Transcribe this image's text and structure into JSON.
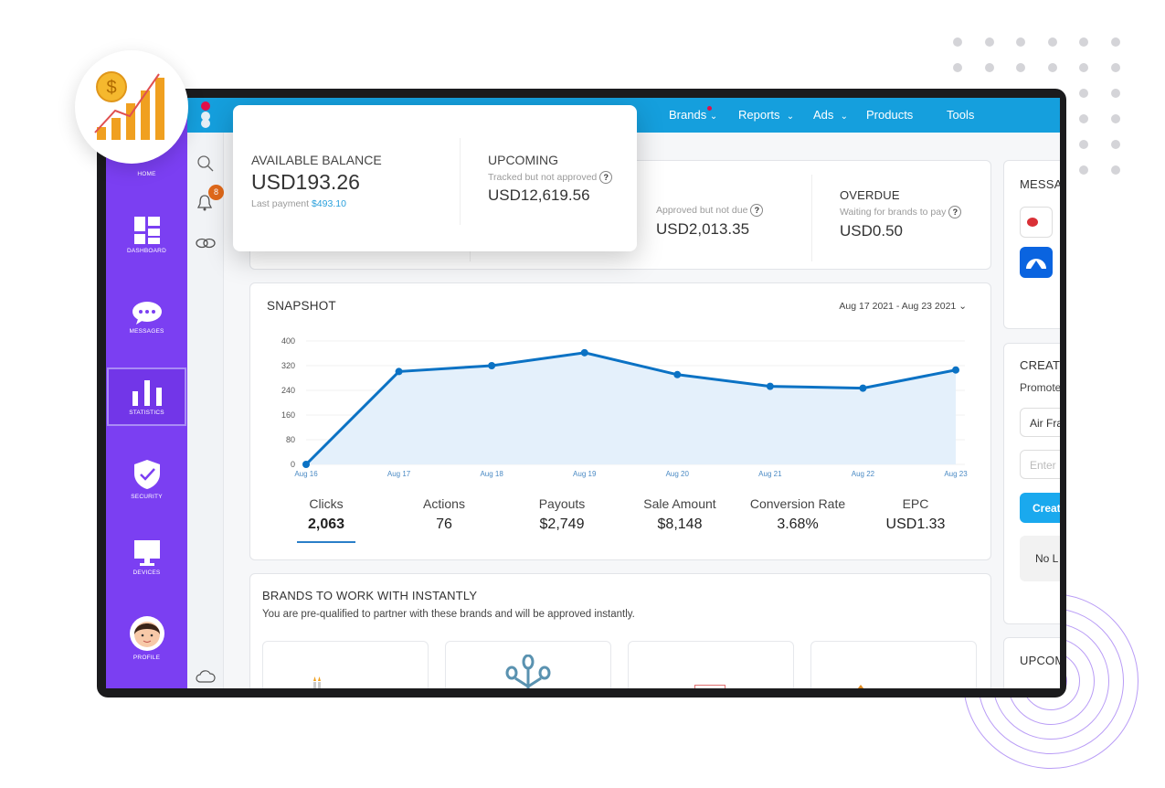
{
  "nav": {
    "items": [
      {
        "label": "Brands",
        "dropdown": true,
        "badge_dot": true
      },
      {
        "label": "Reports",
        "dropdown": true
      },
      {
        "label": "Ads",
        "dropdown": true
      },
      {
        "label": "Products"
      },
      {
        "label": "Tools"
      }
    ]
  },
  "sidebar": {
    "items": [
      {
        "label": "HOME",
        "icon": "home-icon"
      },
      {
        "label": "DASHBOARD",
        "icon": "dashboard-icon"
      },
      {
        "label": "MESSAGES",
        "icon": "chat-bubble-icon"
      },
      {
        "label": "STATISTICS",
        "icon": "bar-chart-icon",
        "active": true
      },
      {
        "label": "SECURITY",
        "icon": "shield-check-icon"
      },
      {
        "label": "DEVICES",
        "icon": "monitor-icon"
      },
      {
        "label": "PROFILE",
        "icon": "avatar-icon"
      }
    ]
  },
  "rail": {
    "notification_count": "8"
  },
  "balance": {
    "title": "AVAILABLE BALANCE",
    "amount": "USD193.26",
    "last_payment_label": "Last payment",
    "last_payment": "$493.10"
  },
  "upcoming": {
    "title": "UPCOMING",
    "sub": "Tracked but not approved",
    "amount": "USD12,619.56"
  },
  "approved": {
    "sub": "Approved but not due",
    "amount": "USD2,013.35"
  },
  "overdue": {
    "title": "OVERDUE",
    "sub": "Waiting for brands to pay",
    "amount": "USD0.50"
  },
  "snapshot": {
    "title": "SNAPSHOT",
    "date_range": "Aug 17 2021 - Aug 23 2021",
    "metrics": [
      {
        "label": "Clicks",
        "value": "2,063",
        "active": true
      },
      {
        "label": "Actions",
        "value": "76"
      },
      {
        "label": "Payouts",
        "value": "$2,749"
      },
      {
        "label": "Sale Amount",
        "value": "$8,148"
      },
      {
        "label": "Conversion Rate",
        "value": "3.68%"
      },
      {
        "label": "EPC",
        "value": "USD1.33"
      }
    ]
  },
  "chart_data": {
    "type": "area",
    "categories": [
      "Aug 16",
      "Aug 17",
      "Aug 18",
      "Aug 19",
      "Aug 20",
      "Aug 21",
      "Aug 22",
      "Aug 23"
    ],
    "values": [
      0,
      301,
      320,
      362,
      291,
      253,
      247,
      306
    ],
    "ylim": [
      0,
      400
    ],
    "yticks": [
      "0",
      "80",
      "160",
      "240",
      "320",
      "400"
    ],
    "grid": true,
    "color": "#0b72c4"
  },
  "brands": {
    "title": "BRANDS TO WORK WITH INSTANTLY",
    "subtitle": "You are pre-qualified to partner with these brands and will be approved instantly."
  },
  "right": {
    "messages_title": "MESSA",
    "create_title": "CREAT",
    "promote_label": "Promote",
    "select_value": "Air Fra",
    "input_placeholder": "Enter",
    "create_button": "Creat",
    "no_links": "No L",
    "upcoming_title": "UPCOM"
  },
  "colors": {
    "sidebar": "#7b3ff2",
    "topbar": "#159fdd",
    "accent": "#159fdd",
    "badge": "#e0691a"
  }
}
